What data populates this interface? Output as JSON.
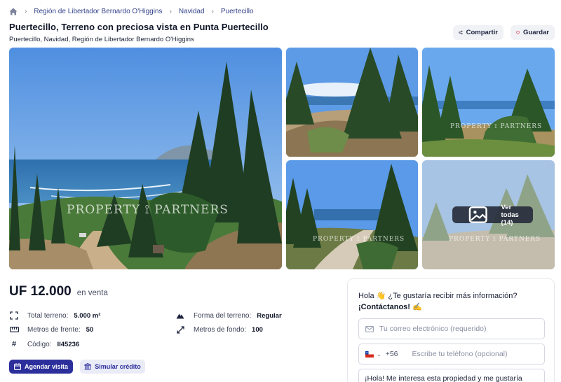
{
  "breadcrumb": {
    "items": [
      "Región de Libertador Bernardo O'Higgins",
      "Navidad",
      "Puertecillo"
    ]
  },
  "listing": {
    "title": "Puertecillo, Terreno con preciosa vista en Punta Puertecillo",
    "location": "Puertecillo, Navidad, Región de Libertador Bernardo O'Higgins"
  },
  "actions": {
    "share_label": "Compartir",
    "save_label": "Guardar"
  },
  "gallery": {
    "watermark_main": "PROPERTY ⟟ PARTNERS",
    "watermark_small": "PROPERTY ⟟ PARTNERS",
    "view_all_label": "Ver todas (14)"
  },
  "price": {
    "amount": "UF 12.000",
    "operation": "en venta"
  },
  "features": {
    "total_label": "Total terreno:",
    "total_value": "5.000 m²",
    "shape_label": "Forma del terreno:",
    "shape_value": "Regular",
    "front_label": "Metros de frente:",
    "front_value": "50",
    "depth_label": "Metros de fondo:",
    "depth_value": "100",
    "code_label": "Código:",
    "code_value": "II45236"
  },
  "buttons": {
    "schedule_label": "Agendar visita",
    "credit_label": "Simular crédito"
  },
  "contact": {
    "hello": "Hola 👋 ¿Te gustaría recibir más información?",
    "cta": "¡Contáctanos! ✍️",
    "email_placeholder": "Tu correo electrónico (requerido)",
    "country_code": "+56",
    "phone_placeholder": "Escribe tu teléfono (opcional)",
    "message_value": "¡Hola! Me interesa esta propiedad y me gustaría"
  },
  "colors": {
    "primary": "#2c2f9b",
    "secondary_bg": "#e9ebf7",
    "heart": "#d6334a"
  }
}
